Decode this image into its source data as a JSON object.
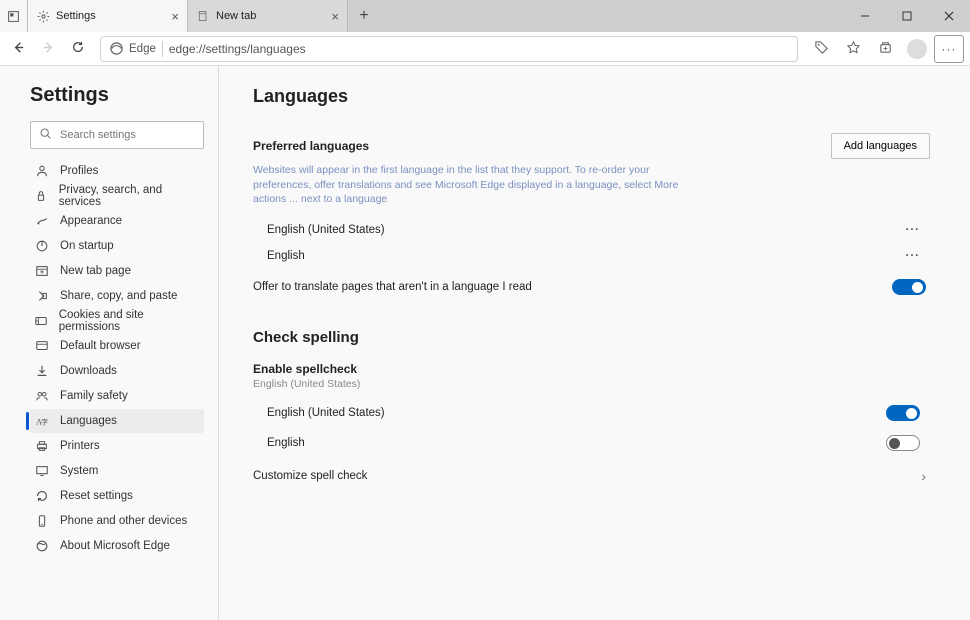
{
  "tabs": [
    {
      "title": "Settings",
      "active": true
    },
    {
      "title": "New tab",
      "active": false
    }
  ],
  "addr": {
    "engine": "Edge",
    "url": "edge://settings/languages"
  },
  "sidebar": {
    "title": "Settings",
    "search_placeholder": "Search settings",
    "items": [
      "Profiles",
      "Privacy, search, and services",
      "Appearance",
      "On startup",
      "New tab page",
      "Share, copy, and paste",
      "Cookies and site permissions",
      "Default browser",
      "Downloads",
      "Family safety",
      "Languages",
      "Printers",
      "System",
      "Reset settings",
      "Phone and other devices",
      "About Microsoft Edge"
    ],
    "selected_index": 10
  },
  "main": {
    "heading": "Languages",
    "preferred": {
      "title": "Preferred languages",
      "add_button": "Add languages",
      "help": "Websites will appear in the first language in the list that they support. To re-order your preferences, offer translations and see Microsoft Edge displayed in a language, select More actions ... next to a language",
      "list": [
        "English (United States)",
        "English"
      ]
    },
    "translate": {
      "label": "Offer to translate pages that aren't in a language I read",
      "on": true
    },
    "spelling": {
      "heading": "Check spelling",
      "enable_label": "Enable spellcheck",
      "enable_desc": "English (United States)",
      "langs": [
        {
          "name": "English (United States)",
          "on": true
        },
        {
          "name": "English",
          "on": false
        }
      ],
      "customize": "Customize spell check"
    }
  }
}
